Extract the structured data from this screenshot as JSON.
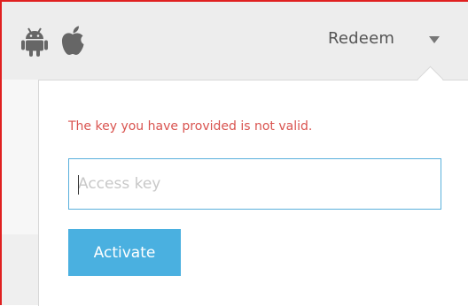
{
  "header": {
    "platform_icons": [
      "android-icon",
      "apple-icon"
    ],
    "redeem_label": "Redeem",
    "dropdown_icon": "chevron-down-icon"
  },
  "redeem_popup": {
    "error_message": "The key you have provided is not valid.",
    "access_key_input": {
      "value": "",
      "placeholder": "Access key"
    },
    "activate_label": "Activate"
  },
  "colors": {
    "window_border": "#e02020",
    "error_text": "#d9534f",
    "input_focus_border": "#5ab0dc",
    "button_background": "#4ab0e0"
  }
}
